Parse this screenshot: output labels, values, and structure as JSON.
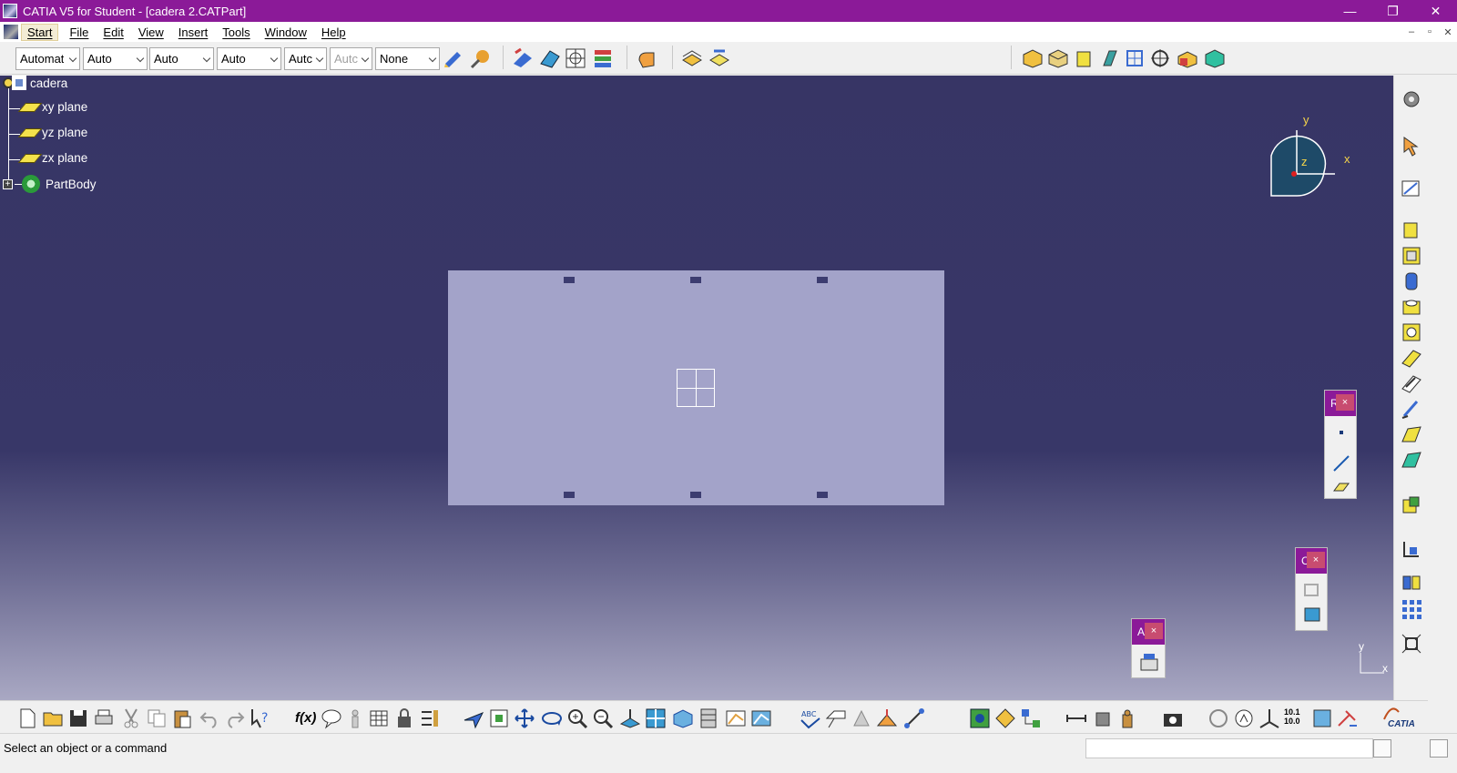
{
  "window": {
    "title": "CATIA V5 for Student - [cadera 2.CATPart]",
    "minimize": "—",
    "restore": "❐",
    "close": "✕"
  },
  "menubar": {
    "items": [
      "Start",
      "File",
      "Edit",
      "View",
      "Insert",
      "Tools",
      "Window",
      "Help"
    ],
    "mdi_min": "–",
    "mdi_restore": "▫",
    "mdi_close": "✕"
  },
  "toolbar": {
    "combos": [
      {
        "value": "Automat",
        "disabled": false
      },
      {
        "value": "Auto",
        "disabled": false
      },
      {
        "value": "Auto",
        "disabled": false
      },
      {
        "value": "Auto",
        "disabled": false
      },
      {
        "value": "Autc",
        "disabled": false
      },
      {
        "value": "Autc",
        "disabled": true
      },
      {
        "value": "None",
        "disabled": false
      }
    ]
  },
  "tree": {
    "root": "cadera",
    "items": [
      "xy plane",
      "yz plane",
      "zx plane",
      "PartBody"
    ]
  },
  "compass": {
    "x": "x",
    "y": "y",
    "z": "z"
  },
  "mini_axis": {
    "x": "x",
    "y": "y"
  },
  "floating_toolbars": [
    {
      "title": "R",
      "close": "×"
    },
    {
      "title": "C",
      "close": "×"
    },
    {
      "title": "A",
      "close": "×"
    }
  ],
  "bottom_labels": {
    "fx": "f(x)",
    "num_top": "10.1",
    "num_bottom": "10.0",
    "brand": "CATIA"
  },
  "status": {
    "message": "Select an object or a command"
  },
  "colors": {
    "titlebar": "#8b1a98",
    "viewport_top": "#373565",
    "sketch": "#a3a3c9",
    "axis_label": "#f5d54a"
  }
}
